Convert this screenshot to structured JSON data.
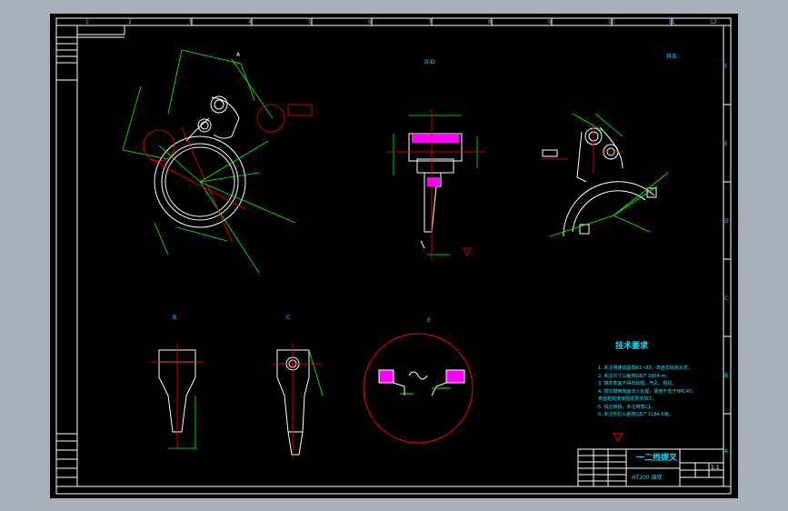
{
  "zones_top": [
    "1",
    "2",
    "3",
    "4",
    "5",
    "6",
    "7",
    "8",
    "9",
    "10",
    "11",
    "12"
  ],
  "zones_side": [
    "F",
    "E",
    "D",
    "C",
    "B",
    "A"
  ],
  "view_labels": {
    "a": "A",
    "b": "B",
    "c": "C",
    "d": "D-D",
    "e": "E"
  },
  "roughness_note": "其余",
  "tech": {
    "heading": "技术要求",
    "lines": [
      "1. 未注明铸造圆角R1~R3，表面去除氧化皮。",
      "2. 未注尺寸公差按GB/T 1804-m。",
      "3. 铸件表面不得有砂眼、气孔、裂纹。",
      "4. 拨叉脚两端面淬火处理，硬度不低于HRC45，",
      "   表面粗糙度按图纸要求加工。",
      "5. 锐边倒钝，未注倒角C1。",
      "6. 未注形位公差按GB/T 1184-K级。"
    ]
  },
  "title_block": {
    "part_name": "一二挡拨叉",
    "material": "HT200 铸铁",
    "scale": "1:1"
  },
  "colors": {
    "frame": "#ffffff",
    "text": "#00e5ff",
    "dimension": "#00ff00",
    "centerline": "#ff0000",
    "hatch": "#ff00ff"
  }
}
